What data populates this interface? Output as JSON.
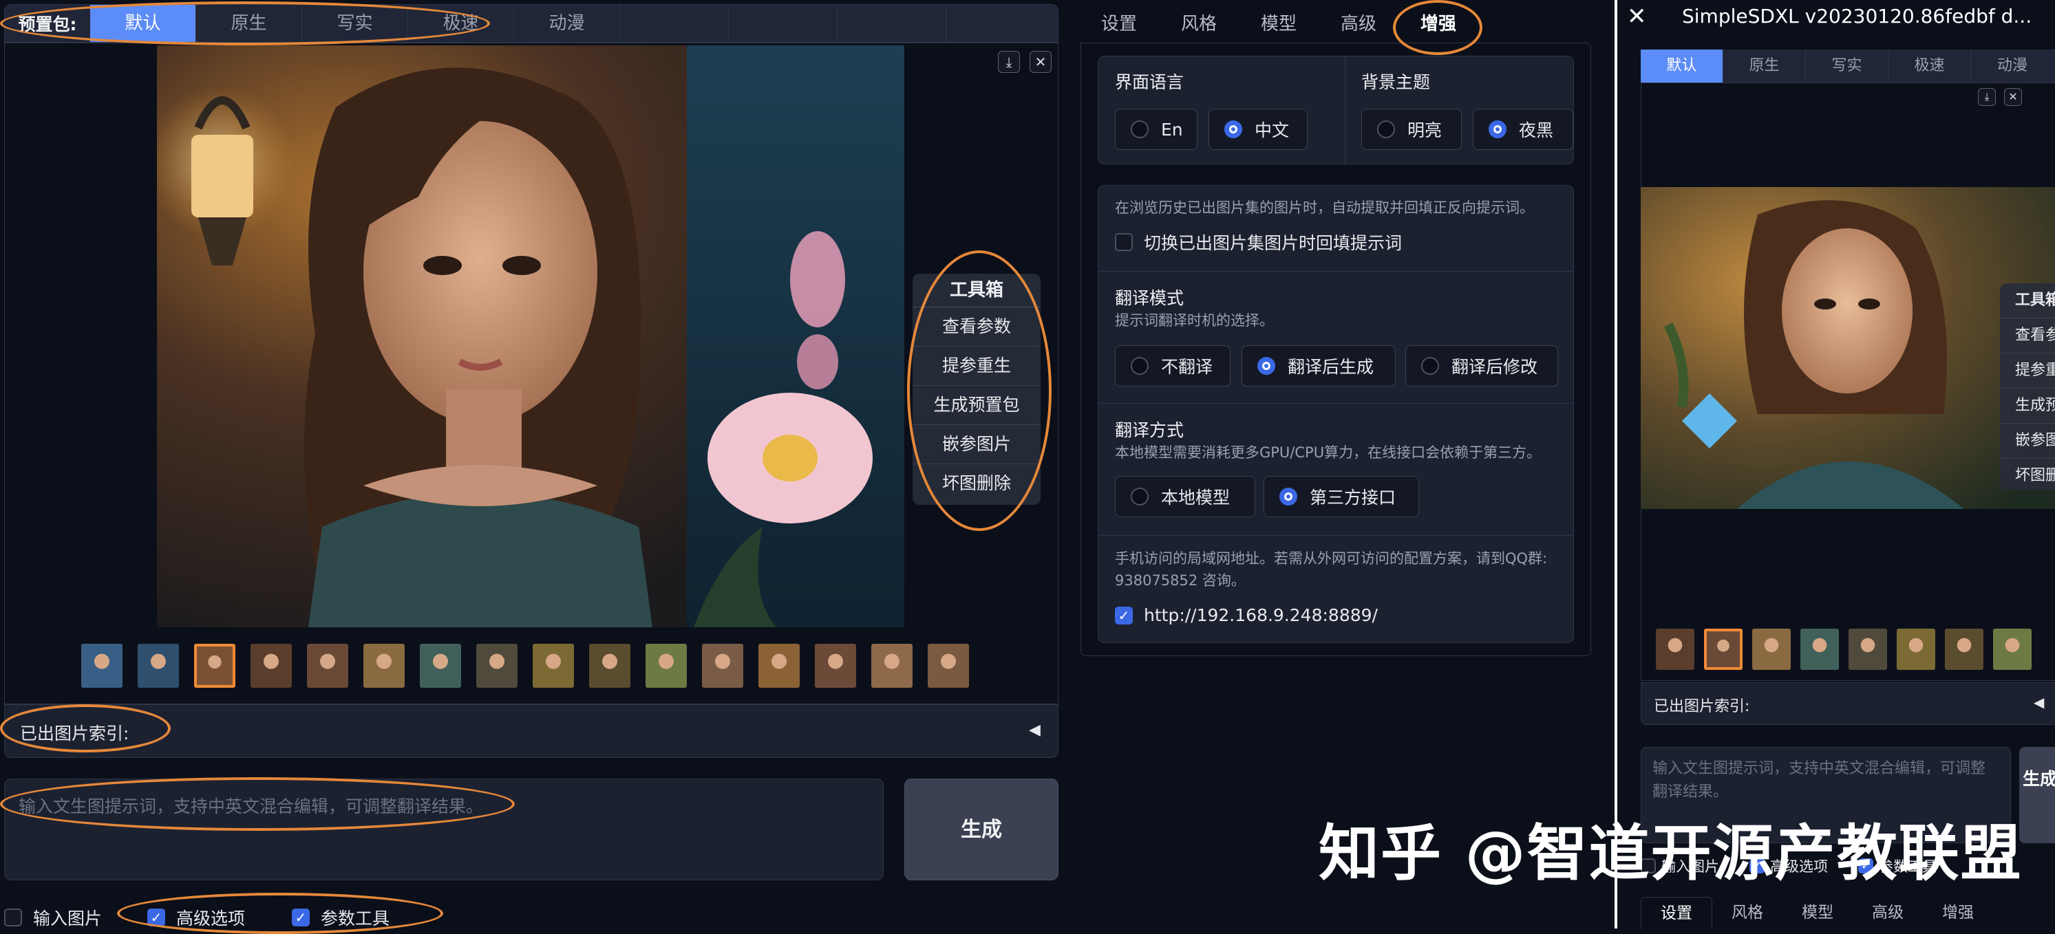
{
  "preset_bar": {
    "label": "预置包:",
    "tabs": [
      "默认",
      "原生",
      "写实",
      "极速",
      "动漫"
    ],
    "active": "默认"
  },
  "gallery": {
    "toolbox": {
      "title": "工具箱",
      "items": [
        "查看参数",
        "提参重生",
        "生成预置包",
        "嵌参图片",
        "坏图删除"
      ]
    },
    "download_icon": "⤓",
    "close_icon": "✕",
    "thumbnail_count": 16,
    "selected_thumbnail": 3
  },
  "index_bar": {
    "label": "已出图片索引:",
    "arrow": "◀"
  },
  "prompt": {
    "placeholder": "输入文生图提示词，支持中英文混合编辑，可调整翻译结果。"
  },
  "generate": {
    "label": "生成"
  },
  "bottom_checks": [
    {
      "label": "输入图片",
      "checked": false
    },
    {
      "label": "高级选项",
      "checked": true
    },
    {
      "label": "参数工具",
      "checked": true
    }
  ],
  "settings": {
    "tabs": [
      "设置",
      "风格",
      "模型",
      "高级",
      "增强"
    ],
    "active_tab": "增强",
    "language": {
      "title": "界面语言",
      "options": [
        "En",
        "中文"
      ],
      "selected": "中文"
    },
    "theme": {
      "title": "背景主题",
      "options": [
        "明亮",
        "夜黑"
      ],
      "selected": "夜黑"
    },
    "history_note": "在浏览历史已出图片集的图片时，自动提取并回填正反向提示词。",
    "history_toggle": {
      "label": "切换已出图片集图片时回填提示词",
      "checked": false
    },
    "translate_mode": {
      "title": "翻译模式",
      "desc": "提示词翻译时机的选择。",
      "options": [
        "不翻译",
        "翻译后生成",
        "翻译后修改"
      ],
      "selected": "翻译后生成"
    },
    "translate_method": {
      "title": "翻译方式",
      "desc": "本地模型需要消耗更多GPU/CPU算力，在线接口会依赖于第三方。",
      "options": [
        "本地模型",
        "第三方接口"
      ],
      "selected": "第三方接口"
    },
    "lan": {
      "desc_line1": "手机访问的局域网地址。若需从外网可访问的配置方案，请到QQ群:",
      "desc_line2": "938075852 咨询。",
      "url": "http://192.168.9.248:8889/",
      "checked": true
    }
  },
  "mobile": {
    "title": "SimpleSDXL v20230120.86fedbf d...",
    "close_icon": "✕",
    "preset_tabs": [
      "默认",
      "原生",
      "写实",
      "极速",
      "动漫"
    ],
    "toolbox": [
      "工具箱",
      "查看参数",
      "提参重生",
      "生成预置包",
      "嵌参图片",
      "坏图删除"
    ],
    "index_label": "已出图片索引:",
    "index_arrow": "◀",
    "prompt_placeholder": "输入文生图提示词，支持中英文混合编辑，可调整翻译结果。",
    "generate_label": "生成",
    "checks": [
      {
        "label": "输入图片",
        "checked": false
      },
      {
        "label": "高级选项",
        "checked": true
      },
      {
        "label": "参数工具",
        "checked": true
      }
    ],
    "settings_tabs": [
      "设置",
      "风格",
      "模型",
      "高级",
      "增强"
    ]
  },
  "watermark": "知乎 @智道开源产教联盟",
  "colors": {
    "accent": "#5c8cf7",
    "annotation": "#e5883a",
    "check": "#3b69e6",
    "background": "#0b0f19"
  }
}
